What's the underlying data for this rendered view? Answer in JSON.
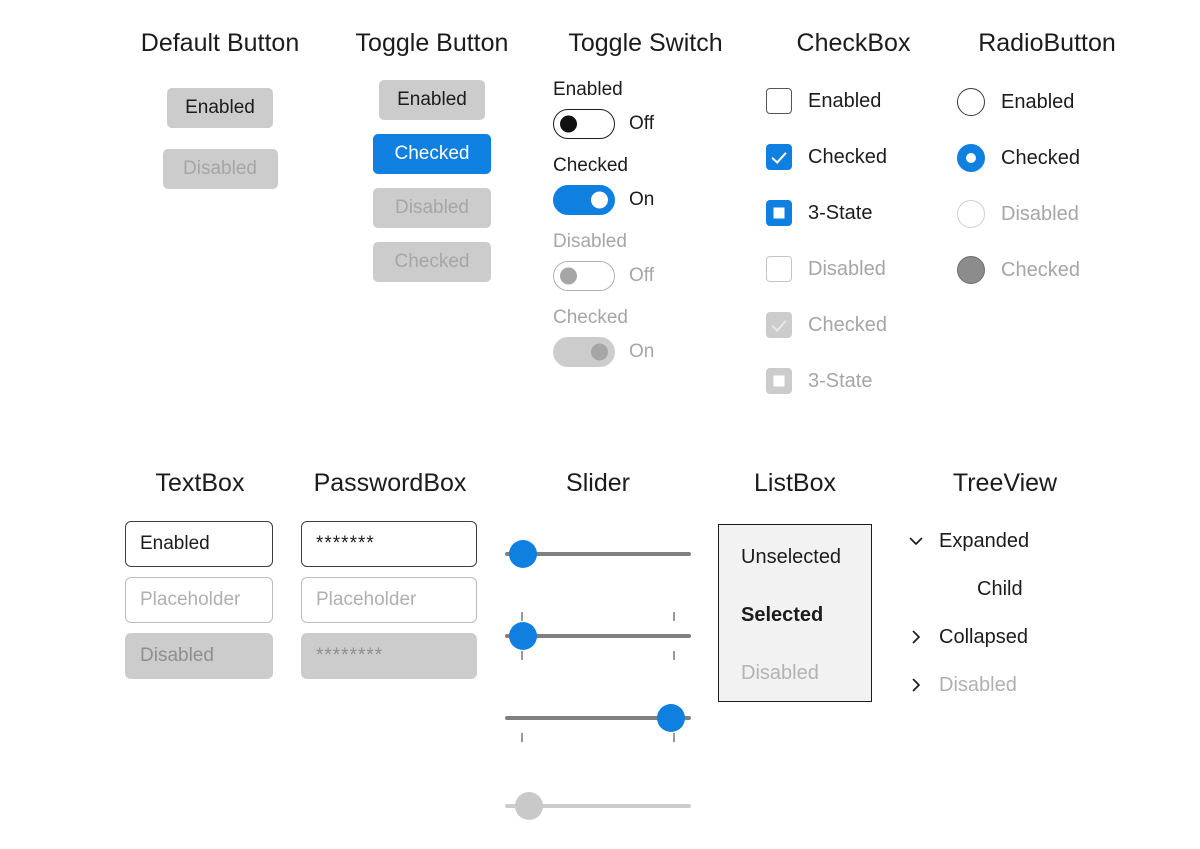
{
  "theme": {
    "accent": "#0f7fe0",
    "disabled_text": "#a6a6a6",
    "control_bg": "#cccccc",
    "listbox_bg": "#f2f2f2",
    "text": "#1c1c1c",
    "page_bg": "#ffffff"
  },
  "columns": {
    "default_button": {
      "title": "Default Button",
      "buttons": [
        {
          "label": "Enabled",
          "state": "enabled"
        },
        {
          "label": "Disabled",
          "state": "disabled"
        }
      ]
    },
    "toggle_button": {
      "title": "Toggle Button",
      "buttons": [
        {
          "label": "Enabled",
          "state": "enabled"
        },
        {
          "label": "Checked",
          "state": "checked"
        },
        {
          "label": "Disabled",
          "state": "disabled"
        },
        {
          "label": "Checked",
          "state": "checked-disabled"
        }
      ]
    },
    "toggle_switch": {
      "title": "Toggle Switch",
      "groups": [
        {
          "header": "Enabled",
          "header_dim": false,
          "state_label": "Off",
          "on": false,
          "disabled": false
        },
        {
          "header": "Checked",
          "header_dim": false,
          "state_label": "On",
          "on": true,
          "disabled": false
        },
        {
          "header": "Disabled",
          "header_dim": true,
          "state_label": "Off",
          "on": false,
          "disabled": true
        },
        {
          "header": "Checked",
          "header_dim": true,
          "state_label": "On",
          "on": true,
          "disabled": true
        }
      ]
    },
    "checkbox": {
      "title": "CheckBox",
      "items": [
        {
          "label": "Enabled",
          "check": "none",
          "disabled": false
        },
        {
          "label": "Checked",
          "check": "checked",
          "disabled": false
        },
        {
          "label": "3-State",
          "check": "indeterminate",
          "disabled": false
        },
        {
          "label": "Disabled",
          "check": "none",
          "disabled": true
        },
        {
          "label": "Checked",
          "check": "checked",
          "disabled": true
        },
        {
          "label": "3-State",
          "check": "indeterminate",
          "disabled": true
        }
      ]
    },
    "radiobutton": {
      "title": "RadioButton",
      "items": [
        {
          "label": "Enabled",
          "checked": false,
          "disabled": false
        },
        {
          "label": "Checked",
          "checked": true,
          "disabled": false
        },
        {
          "label": "Disabled",
          "checked": false,
          "disabled": true
        },
        {
          "label": "Checked",
          "checked": true,
          "disabled": true
        }
      ]
    },
    "textbox": {
      "title": "TextBox",
      "fields": [
        {
          "value": "Enabled",
          "kind": "value",
          "disabled": false
        },
        {
          "value": "Placeholder",
          "kind": "placeholder",
          "disabled": false
        },
        {
          "value": "Disabled",
          "kind": "value",
          "disabled": true
        }
      ]
    },
    "passwordbox": {
      "title": "PasswordBox",
      "fields": [
        {
          "value": "*******",
          "kind": "value",
          "disabled": false
        },
        {
          "value": "Placeholder",
          "kind": "placeholder",
          "disabled": false
        },
        {
          "value": "********",
          "kind": "value",
          "disabled": true
        }
      ]
    },
    "slider": {
      "title": "Slider",
      "sliders": [
        {
          "percent": 0,
          "ticks": "none",
          "disabled": false
        },
        {
          "percent": 0,
          "ticks": "both",
          "disabled": false
        },
        {
          "percent": 90,
          "ticks": "below",
          "disabled": false
        },
        {
          "percent": 0,
          "ticks": "none",
          "disabled": true
        }
      ]
    },
    "listbox": {
      "title": "ListBox",
      "items": [
        {
          "label": "Unselected",
          "selected": false,
          "disabled": false
        },
        {
          "label": "Selected",
          "selected": true,
          "disabled": false
        },
        {
          "label": "Disabled",
          "selected": false,
          "disabled": true
        }
      ]
    },
    "treeview": {
      "title": "TreeView",
      "nodes": [
        {
          "label": "Expanded",
          "icon": "chevron-down-icon",
          "disabled": false,
          "child": false
        },
        {
          "label": "Child",
          "icon": "none",
          "disabled": false,
          "child": true
        },
        {
          "label": "Collapsed",
          "icon": "chevron-right-icon",
          "disabled": false,
          "child": false
        },
        {
          "label": "Disabled",
          "icon": "chevron-right-icon",
          "disabled": true,
          "child": false
        }
      ]
    }
  }
}
